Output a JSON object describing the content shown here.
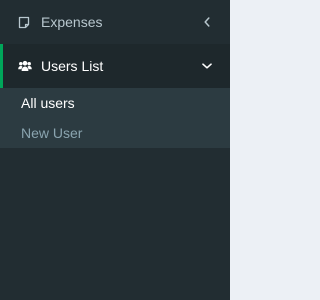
{
  "sidebar": {
    "items": [
      {
        "label": "Expenses",
        "icon": "document-icon",
        "expanded": false
      },
      {
        "label": "Users List",
        "icon": "users-icon",
        "expanded": true
      }
    ],
    "submenu": [
      {
        "label": "All users",
        "active": true
      },
      {
        "label": "New User",
        "active": false
      }
    ]
  },
  "colors": {
    "sidebar_bg": "#222d32",
    "active_item_bg": "#1e282c",
    "submenu_bg": "#2c3b41",
    "accent": "#00a65a",
    "text_muted": "#b8c7ce",
    "text_active": "#ffffff",
    "submenu_muted": "#8aa4af",
    "content_bg": "#ecf0f5"
  }
}
